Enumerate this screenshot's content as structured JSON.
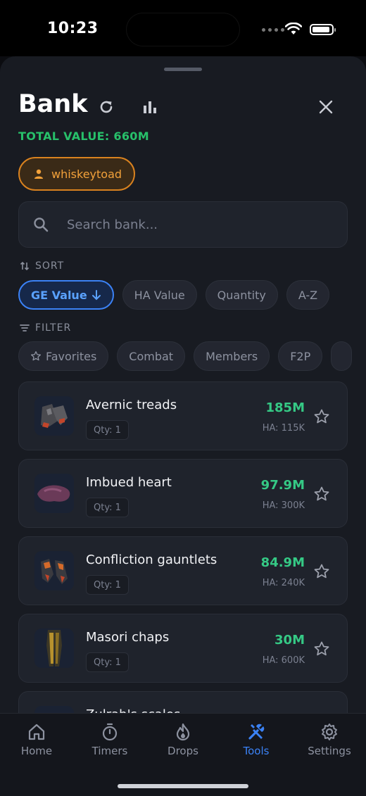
{
  "status": {
    "time": "10:23"
  },
  "header": {
    "title": "Bank",
    "total_value": "TOTAL VALUE: 660M"
  },
  "account": {
    "name": "whiskeytoad"
  },
  "search": {
    "placeholder": "Search bank..."
  },
  "sort": {
    "label": "SORT",
    "options": [
      "GE Value",
      "HA Value",
      "Quantity",
      "A-Z"
    ],
    "selected": "GE Value"
  },
  "filter": {
    "label": "FILTER",
    "options": [
      "Favorites",
      "Combat",
      "Members",
      "F2P"
    ]
  },
  "items": [
    {
      "name": "Avernic treads",
      "qty": "Qty: 1",
      "ge": "185M",
      "ha": "HA: 115K"
    },
    {
      "name": "Imbued heart",
      "qty": "Qty: 1",
      "ge": "97.9M",
      "ha": "HA: 300K"
    },
    {
      "name": "Confliction gauntlets",
      "qty": "Qty: 1",
      "ge": "84.9M",
      "ha": "HA: 240K"
    },
    {
      "name": "Masori chaps",
      "qty": "Qty: 1",
      "ge": "30M",
      "ha": "HA: 600K"
    },
    {
      "name": "Zulrah's scales",
      "qty": "",
      "ge": "",
      "ha": ""
    }
  ],
  "tabs": [
    {
      "label": "Home",
      "icon": "home-icon"
    },
    {
      "label": "Timers",
      "icon": "stopwatch-icon"
    },
    {
      "label": "Drops",
      "icon": "flame-icon"
    },
    {
      "label": "Tools",
      "icon": "tools-icon"
    },
    {
      "label": "Settings",
      "icon": "gear-icon"
    }
  ],
  "active_tab": "Tools",
  "colors": {
    "accent": "#3b82f6",
    "positive": "#35c985",
    "account": "#d9821f"
  }
}
